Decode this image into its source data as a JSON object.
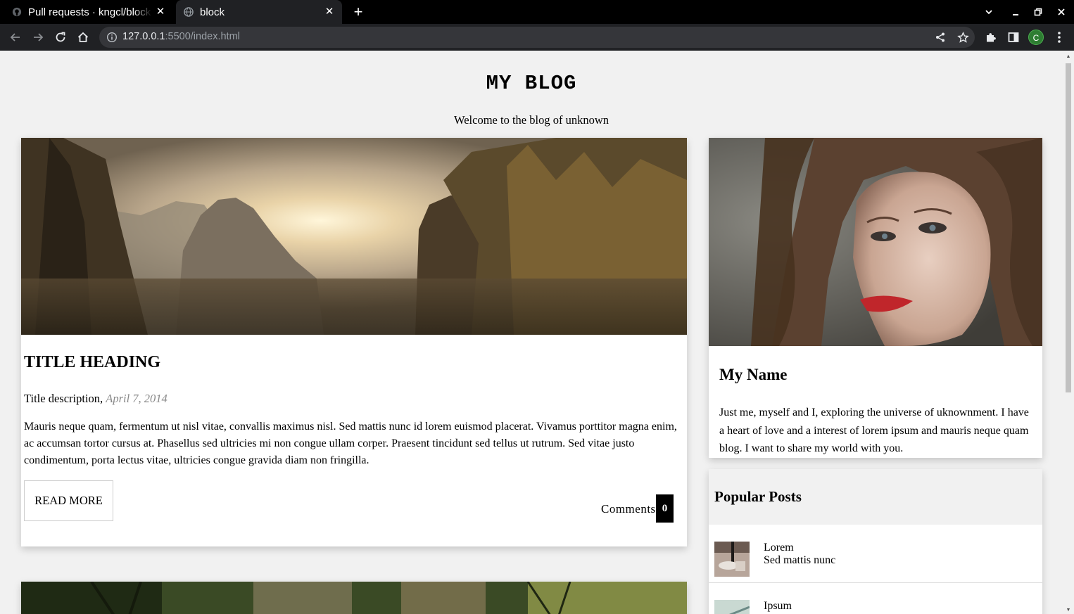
{
  "browser": {
    "tabs": [
      {
        "label": "Pull requests · kngcl/block",
        "icon": "github-icon",
        "active": false
      },
      {
        "label": "block",
        "icon": "globe-icon",
        "active": true
      }
    ],
    "url_host": "127.0.0.1",
    "url_rest": ":5500/index.html",
    "profile_initial": "C",
    "colors": {
      "tab_strip": "#000000",
      "toolbar": "#202124",
      "omnibox": "#35363a",
      "avatar": "#2e7d32"
    }
  },
  "header": {
    "title": "MY BLOG",
    "subtitle": "Welcome to the blog of unknown"
  },
  "post": {
    "title": "TITLE HEADING",
    "description": "Title description,",
    "date": "April 7, 2014",
    "body": "Mauris neque quam, fermentum ut nisl vitae, convallis maximus nisl. Sed mattis nunc id lorem euismod placerat. Vivamus porttitor magna enim, ac accumsan tortor cursus at. Phasellus sed ultricies mi non congue ullam corper. Praesent tincidunt sed tellus ut rutrum. Sed vitae justo condimentum, porta lectus vitae, ultricies congue gravida diam non fringilla.",
    "read_more": "READ MORE",
    "comments_label": "Comments",
    "comments_count": "0"
  },
  "profile": {
    "name": "My Name",
    "bio": "Just me, myself and I, exploring the universe of uknownment. I have a heart of love and a interest of lorem ipsum and mauris neque quam blog. I want to share my world with you."
  },
  "popular": {
    "title": "Popular Posts",
    "items": [
      {
        "title": "Lorem",
        "subtitle": "Sed mattis nunc"
      },
      {
        "title": "Ipsum",
        "subtitle": ""
      }
    ]
  }
}
